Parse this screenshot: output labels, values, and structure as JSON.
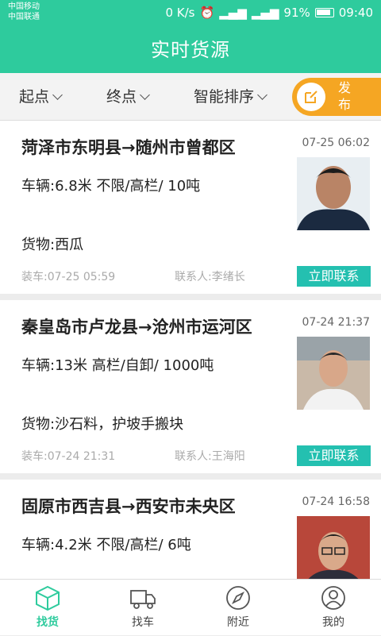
{
  "status": {
    "carrier1": "中国移动",
    "carrier2": "中国联通",
    "speed": "0 K/s",
    "battery": "91%",
    "time": "09:40"
  },
  "header": {
    "title": "实时货源"
  },
  "filters": {
    "start": "起点",
    "end": "终点",
    "sort": "智能排序"
  },
  "publish": {
    "label": "发布"
  },
  "cards": [
    {
      "route": "菏泽市东明县→随州市曾都区",
      "date": "07-25 06:02",
      "vehicle": "车辆:6.8米 不限/高栏/ 10吨",
      "goods": "货物:西瓜",
      "load": "装车:07-25 05:59",
      "contact": "联系人:李绪长",
      "call": "立即联系"
    },
    {
      "route": "秦皇岛市卢龙县→沧州市运河区",
      "date": "07-24 21:37",
      "vehicle": "车辆:13米 高栏/自卸/ 1000吨",
      "goods": "货物:沙石料，护坡手搬块",
      "load": "装车:07-24 21:31",
      "contact": "联系人:王海阳",
      "call": "立即联系"
    },
    {
      "route": "固原市西吉县→西安市未央区",
      "date": "07-24 16:58",
      "vehicle": "车辆:4.2米 不限/高栏/ 6吨",
      "goods": "",
      "load": "",
      "contact": "",
      "call": ""
    }
  ],
  "tabs": [
    {
      "label": "找货",
      "icon": "box-icon",
      "active": true
    },
    {
      "label": "找车",
      "icon": "truck-icon",
      "active": false
    },
    {
      "label": "附近",
      "icon": "compass-icon",
      "active": false
    },
    {
      "label": "我的",
      "icon": "user-icon",
      "active": false
    }
  ],
  "colors": {
    "brand": "#2ecb9d",
    "publish": "#f5a623",
    "call": "#24c0b0"
  }
}
